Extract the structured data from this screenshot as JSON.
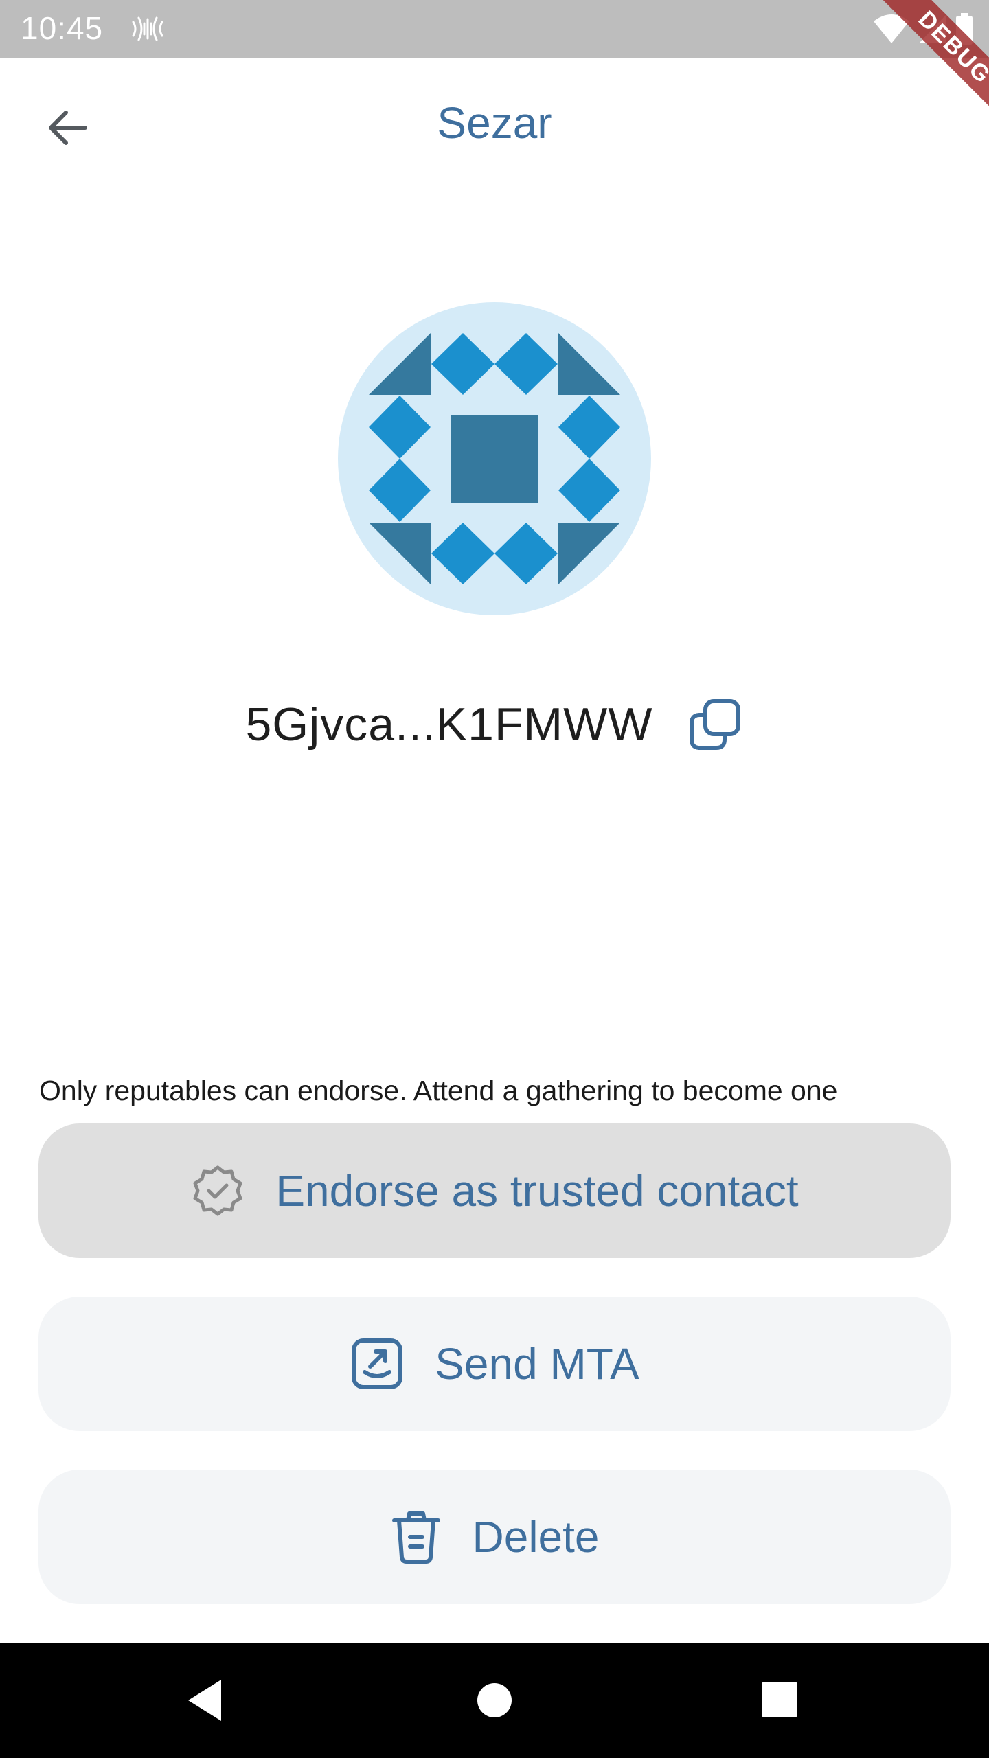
{
  "status_bar": {
    "time": "10:45",
    "icons": [
      "signal-wave-icon",
      "wifi-icon",
      "cellular-icon",
      "battery-icon"
    ]
  },
  "debug_banner": {
    "label": "DEBUG"
  },
  "app_bar": {
    "title": "Sezar",
    "back_icon": "arrow-left-icon"
  },
  "contact": {
    "avatar": "identicon",
    "address": "5Gjvca...K1FMWW",
    "copy_icon": "copy-icon"
  },
  "info": {
    "text": "Only reputables can endorse. Attend a gathering to become one"
  },
  "actions": {
    "endorse": {
      "label": "Endorse as trusted contact",
      "icon": "verified-badge-icon",
      "disabled": true
    },
    "send": {
      "label": "Send MTA",
      "icon": "send-arrow-icon"
    },
    "delete": {
      "label": "Delete",
      "icon": "trash-icon"
    }
  },
  "nav_bar": {
    "items": [
      "back-triangle-icon",
      "home-circle-icon",
      "recents-square-icon"
    ]
  },
  "colors": {
    "accent": "#3f6f9e",
    "identicon_bg": "#d5ebf8",
    "identicon_dark": "#35799e",
    "identicon_light": "#1b90ce",
    "disabled_button_bg": "#dfdfdf",
    "button_bg": "#f3f5f7"
  }
}
